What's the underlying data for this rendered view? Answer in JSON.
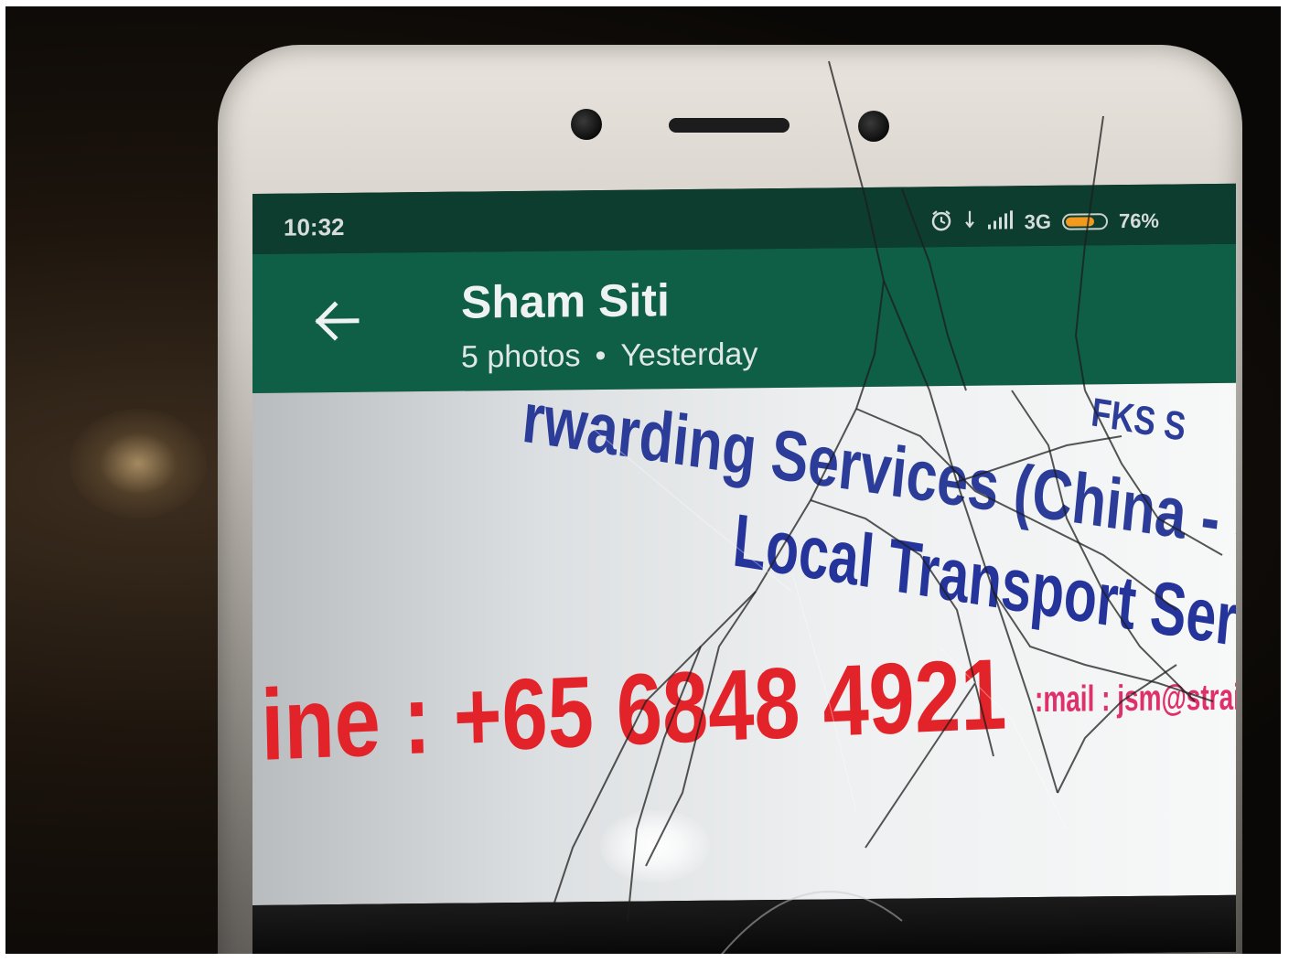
{
  "status_bar": {
    "time": "10:32",
    "network": "3G",
    "battery": "76%",
    "battery_level": 0.76,
    "alarm_icon": "alarm-icon",
    "download_icon": "download-icon",
    "signal_icon": "signal-icon"
  },
  "app_bar": {
    "title": "Sham Siti",
    "photo_count": "5 photos",
    "separator": "•",
    "date": "Yesterday",
    "back_icon": "arrow-left-icon"
  },
  "photo_content": {
    "line_1": "rwarding Services (China - S",
    "line_1_right": "FKS S",
    "line_2": "Local Transport Services",
    "phone_line": "ine : +65 6848 4921",
    "email_line": ":mail : jsm@strait"
  },
  "colors": {
    "status_bar": "#0d3d2f",
    "app_bar": "#0f5e46",
    "sign_blue": "#2c3d99",
    "sign_red": "#e3232a",
    "sign_pink": "#e0306a",
    "battery": "#f39a1e"
  }
}
